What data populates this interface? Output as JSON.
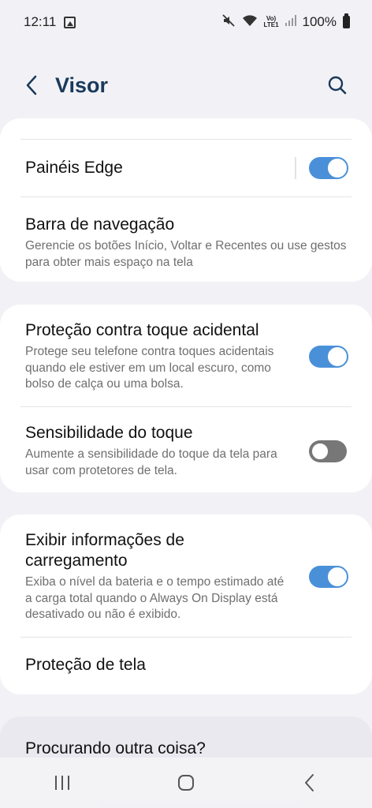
{
  "status": {
    "time": "12:11",
    "volte": "Vo)\nLTE1",
    "battery": "100%"
  },
  "header": {
    "title": "Visor"
  },
  "card1": {
    "edge_panels": {
      "title": "Painéis Edge",
      "enabled": true
    },
    "nav_bar": {
      "title": "Barra de navegação",
      "subtitle": "Gerencie os botões Início, Voltar e Recentes ou use gestos para obter mais espaço na tela"
    }
  },
  "card2": {
    "accidental_touch": {
      "title": "Proteção contra toque acidental",
      "subtitle": "Protege seu telefone contra toques acidentais quando ele estiver em um local escuro, como bolso de calça ou uma bolsa.",
      "enabled": true
    },
    "touch_sensitivity": {
      "title": "Sensibilidade do toque",
      "subtitle": "Aumente a sensibilidade do toque da tela para usar com protetores de tela.",
      "enabled": false
    }
  },
  "card3": {
    "charging_info": {
      "title": "Exibir informações de carregamento",
      "subtitle": "Exiba o nível da bateria e o tempo estimado até a carga total quando o Always On Display está desativado ou não é exibido.",
      "enabled": true
    },
    "screen_saver": {
      "title": "Proteção de tela"
    }
  },
  "card4": {
    "looking_for": {
      "title": "Procurando outra coisa?"
    }
  },
  "colors": {
    "accent": "#4a90d9",
    "title": "#1a3a5c",
    "background": "#f2f2f6"
  }
}
